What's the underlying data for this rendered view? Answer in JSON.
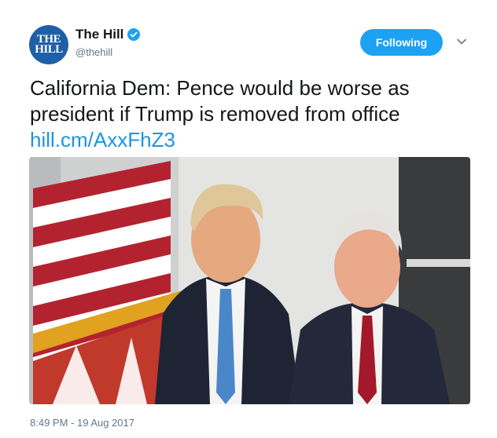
{
  "account": {
    "display_name": "The Hill",
    "handle": "@thehill",
    "avatar_text": "THE\nHILL",
    "verified": true
  },
  "follow_button": {
    "label": "Following"
  },
  "tweet": {
    "text": "California Dem: Pence would be worse as president if Trump is removed from office",
    "link": "hill.cm/AxxFhZ3",
    "timestamp": "8:49 PM - 19 Aug 2017"
  },
  "media": {
    "kind": "photo",
    "subject": "two men in suits standing beside an American flag"
  },
  "colors": {
    "accent": "#1da1f2",
    "link": "#1b95e0",
    "text": "#14171a",
    "secondary_text": "#657786",
    "avatar_bg": "#1f5fa8"
  },
  "icons": {
    "verified": "verified-badge-icon",
    "caret": "chevron-down-icon"
  }
}
